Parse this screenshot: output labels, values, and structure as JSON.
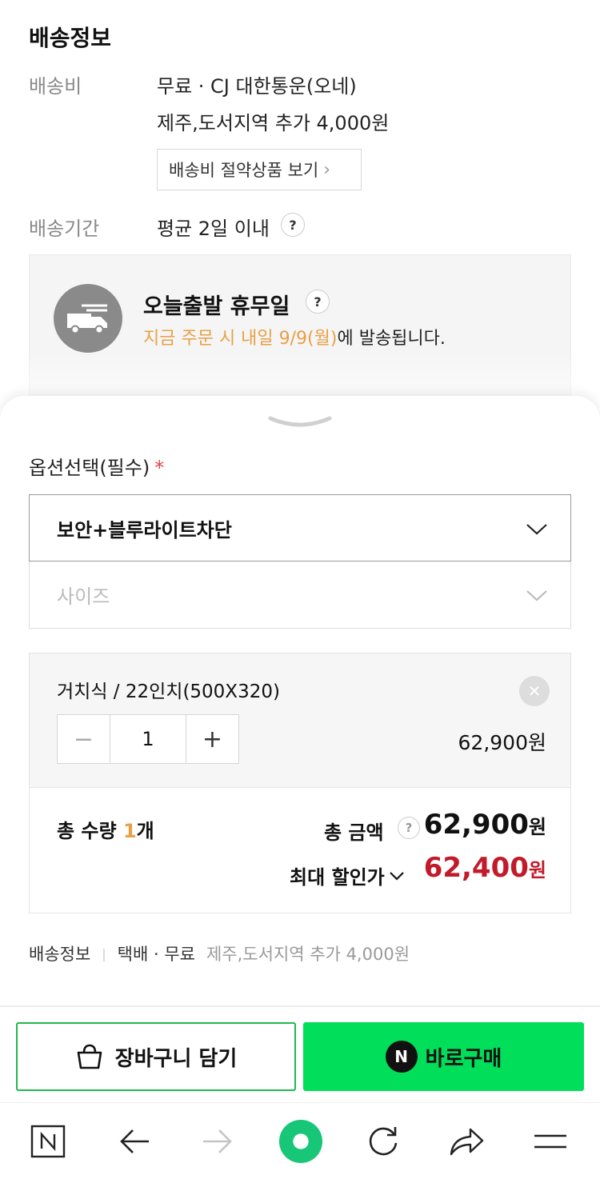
{
  "shipping": {
    "title": "배송정보",
    "fee_label": "배송비",
    "fee_value": "무료 · CJ 대한통운(오네)",
    "fee_extra": "제주,도서지역 추가 4,000원",
    "save_button": "배송비 절약상품 보기",
    "period_label": "배송기간",
    "period_value": "평균 2일 이내",
    "help_glyph": "?"
  },
  "today_ship": {
    "title": "오늘출발 휴무일",
    "highlight": "지금 주문 시 내일 9/9(월)",
    "suffix": "에 발송됩니다."
  },
  "options": {
    "title": "옵션선택(필수)",
    "required_mark": "*",
    "selected": "보안+블루라이트차단",
    "size_placeholder": "사이즈"
  },
  "item": {
    "name": "거치식 / 22인치(500X320)",
    "quantity": "1",
    "price": "62,900원",
    "minus": "−",
    "plus": "+",
    "remove": "✕"
  },
  "totals": {
    "qty_label": "총 수량 ",
    "qty_num": "1",
    "qty_unit": "개",
    "amount_label": "총 금액",
    "amount_value": "62,900",
    "amount_unit": "원",
    "discount_label": "최대 할인가",
    "discount_value": "62,400",
    "discount_unit": "원"
  },
  "ship_summary": {
    "label": "배송정보",
    "sep": "|",
    "method": "택배 · 무료",
    "extra": "제주,도서지역 추가 4,000원"
  },
  "actions": {
    "cart": "장바구니 담기",
    "buy": "바로구매",
    "n_badge": "N"
  },
  "colors": {
    "accent_green": "#00de5a",
    "orange": "#e8a045",
    "discount_red": "#c11b2b"
  },
  "icons": [
    "truck-icon",
    "cart-bag-icon",
    "naver-n-icon",
    "browser-home-icon",
    "back-arrow-icon",
    "forward-arrow-icon",
    "green-dot-icon",
    "refresh-icon",
    "share-icon",
    "menu-icon"
  ]
}
